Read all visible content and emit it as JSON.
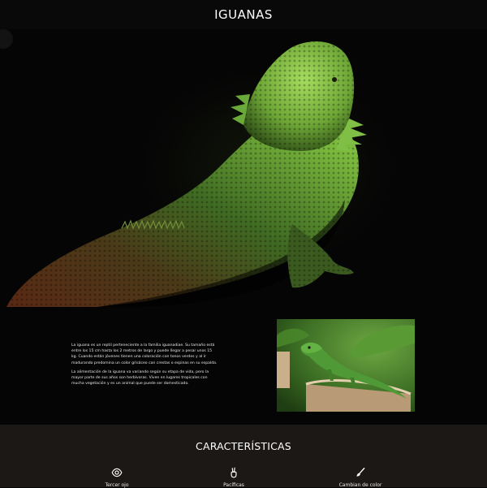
{
  "header": {
    "title": "IGUANAS"
  },
  "hero": {
    "image": "bearded-dragon-photo"
  },
  "intro": {
    "paragraphs": [
      "La iguana es un reptil perteneciente a la familia iguanadiae. Su tamaño está entre los 15 cm hasta los 2 metros de largo y puede llegar a pesar unos 15 kg. Cuando están jóvenes tienen una coloración con tonos verdes y al ir madurando predomina un color grisáceo con crestas o espinas en su espalda.",
      "La alimentación de la iguana va variando según su etapa de vida, pero la mayor parte de sus años son herbívoras. Viven en lugares tropicales con mucha vegetación y es un animal que puede ser domesticado."
    ],
    "photo": "green-iguana-on-stump-photo"
  },
  "features": {
    "title": "CARACTERÍSTICAS",
    "items": [
      {
        "label": "Tercer ojo",
        "icon": "eye-icon"
      },
      {
        "label": "Pacíficas",
        "icon": "peace-hand-icon"
      },
      {
        "label": "Cambian de color",
        "icon": "paint-brush-icon"
      }
    ]
  }
}
